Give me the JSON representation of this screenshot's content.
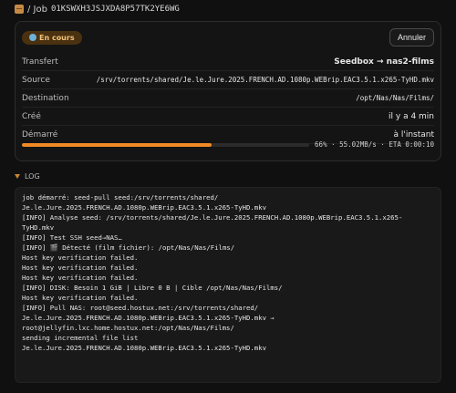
{
  "header": {
    "icon": "package-icon",
    "prefix": "/ Job",
    "job_id": "01KSWXH3JSJXDA8P57TK2YE6WG"
  },
  "status": {
    "badge_label": "En cours",
    "badge_icon": "gear-icon",
    "cancel_label": "Annuler"
  },
  "details": [
    {
      "label": "Transfert",
      "value": "Seedbox → nas2-films"
    },
    {
      "label": "Source",
      "value": "/srv/torrents/shared/Je.le.Jure.2025.FRENCH.AD.1080p.WEBrip.EAC3.5.1.x265-TyHD.mkv"
    },
    {
      "label": "Destination",
      "value": "/opt/Nas/Nas/Films/"
    },
    {
      "label": "Créé",
      "value": "il y a 4 min"
    },
    {
      "label": "Démarré",
      "value": "à l'instant"
    }
  ],
  "progress": {
    "percent": 66,
    "text": "66% · 55.02MB/s · ETA 0:00:10",
    "color": "#f08a24"
  },
  "log": {
    "title": "LOG",
    "lines": [
      "job démarré: seed-pull seed:/srv/torrents/shared/",
      "Je.le.Jure.2025.FRENCH.AD.1080p.WEBrip.EAC3.5.1.x265-TyHD.mkv",
      "[INFO] Analyse seed: /srv/torrents/shared/Je.le.Jure.2025.FRENCH.AD.1080p.WEBrip.EAC3.5.1.x265-",
      "TyHD.mkv",
      "[INFO] Test SSH seed→NAS…",
      "[INFO] 🎬 Détecté (film fichier): /opt/Nas/Nas/Films/",
      "Host key verification failed.",
      "Host key verification failed.",
      "Host key verification failed.",
      "[INFO] DISK: Besoin 1 GiB | Libre 0 B | Cible /opt/Nas/Nas/Films/",
      "Host key verification failed.",
      "[INFO] Pull NAS: root@seed.hostux.net:/srv/torrents/shared/",
      "Je.le.Jure.2025.FRENCH.AD.1080p.WEBrip.EAC3.5.1.x265-TyHD.mkv →",
      "root@jellyfin.lxc.home.hostux.net:/opt/Nas/Nas/Films/",
      "sending incremental file list",
      "Je.le.Jure.2025.FRENCH.AD.1080p.WEBrip.EAC3.5.1.x265-TyHD.mkv"
    ]
  }
}
